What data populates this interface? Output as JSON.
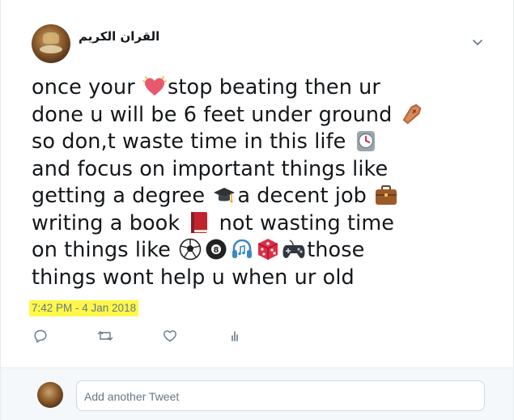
{
  "tweet": {
    "author_name": "القران الكريم",
    "lines": [
      [
        "once your ",
        "heart",
        "stop beating then ur"
      ],
      [
        "done u will be 6 feet under ground ",
        "coffin"
      ],
      [
        "so don,t waste time in this life ",
        "clock"
      ],
      [
        "and focus on important things like"
      ],
      [
        "getting a degree ",
        "graduation-cap",
        "a decent job ",
        "briefcase"
      ],
      [
        "writing a book ",
        "book",
        " not wasting time"
      ],
      [
        "on things like ",
        "soccer-ball",
        "eight-ball",
        "headphones",
        "dice",
        "gamepad",
        "those"
      ],
      [
        "things wont help u when ur old"
      ]
    ],
    "timestamp": "7:42 PM - 4 Jan 2018"
  },
  "actions": [
    "reply-icon",
    "retweet-icon",
    "like-icon",
    "analytics-icon"
  ],
  "reply": {
    "placeholder": "Add another Tweet"
  },
  "colors": {
    "text": "#14171a",
    "muted": "#657786",
    "highlight": "#fff84a",
    "reply_bg": "#f5f8fa",
    "input_border": "#c7dbe8"
  }
}
